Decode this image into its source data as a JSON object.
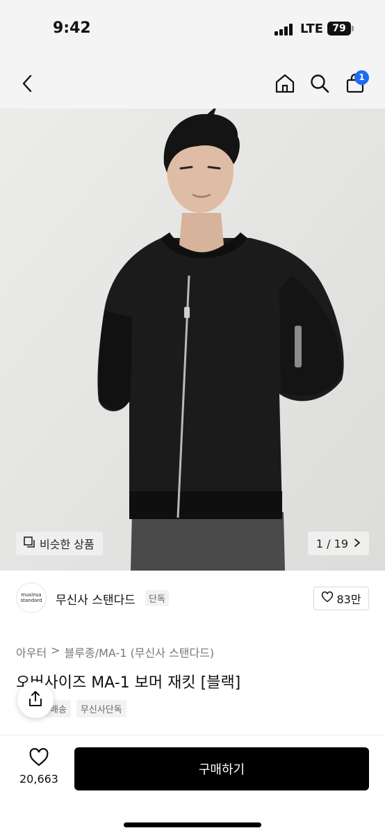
{
  "status_bar": {
    "time": "9:42",
    "network": "LTE",
    "battery": "79"
  },
  "nav": {
    "cart_count": "1"
  },
  "product_image": {
    "similar_label": "비슷한 상품",
    "page_indicator": "1 / 19"
  },
  "brand": {
    "logo_line1": "musinsa",
    "logo_line2": "standard",
    "name": "무신사 스탠다드",
    "tag": "단독",
    "likes": "83만"
  },
  "breadcrumb": {
    "category": "아우터",
    "subcategory": "블루종/MA-1 (무신사 스탠다드)"
  },
  "product": {
    "title": "오버사이즈 MA-1 보머 재킷 [블랙]",
    "badges": [
      "배송",
      "무신사단독"
    ]
  },
  "bottom_bar": {
    "wish_count": "20,663",
    "buy_label": "구매하기"
  }
}
